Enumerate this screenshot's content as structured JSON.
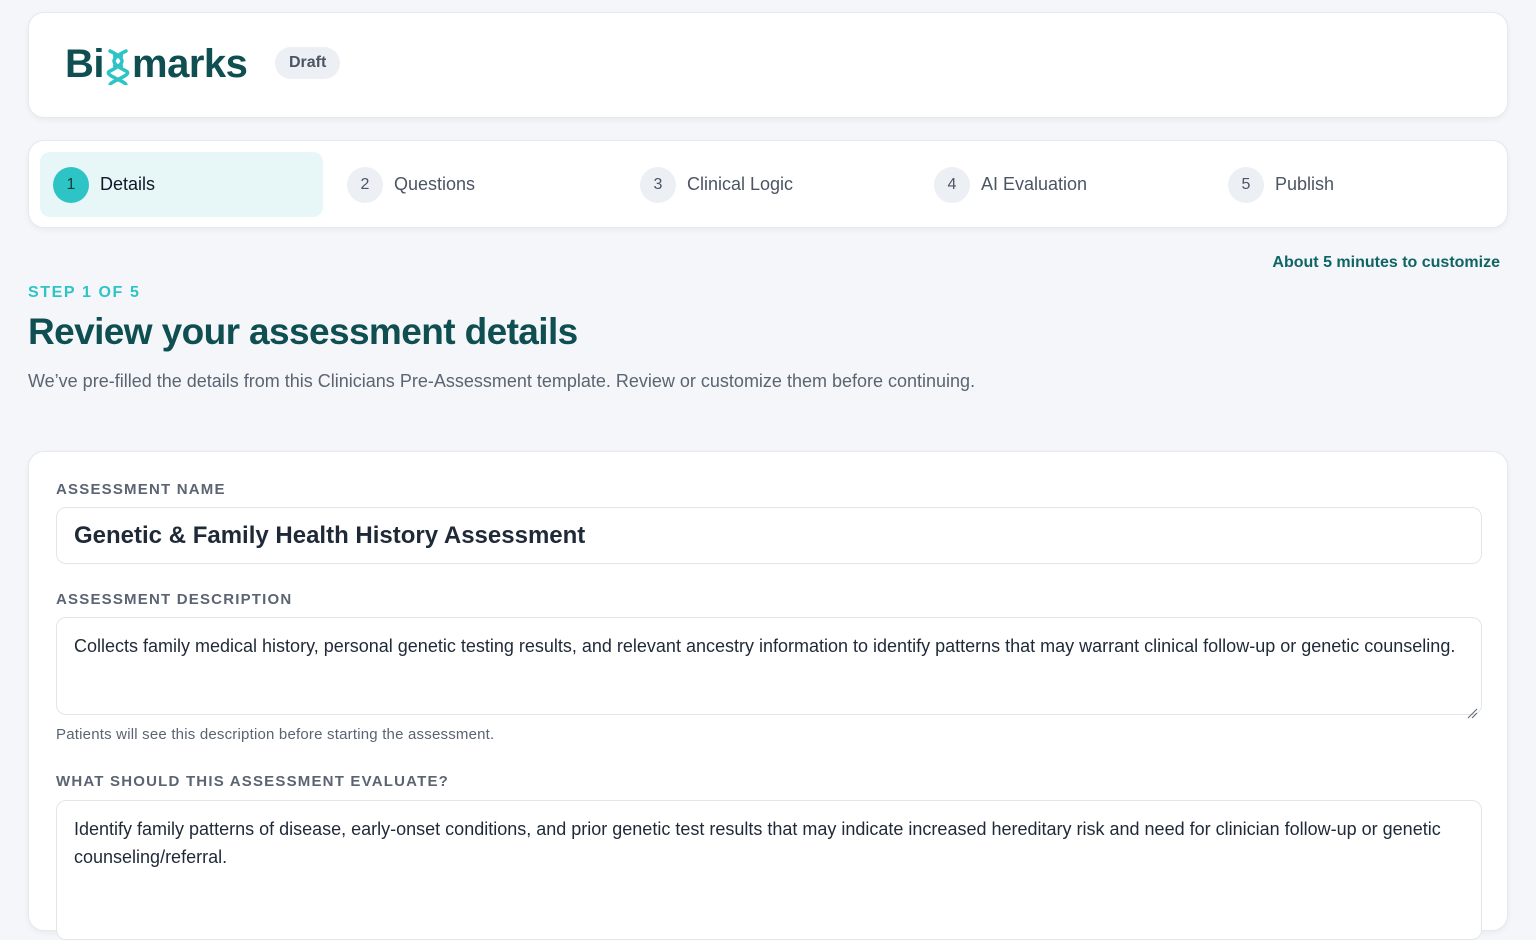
{
  "header": {
    "logo_text_a": "Bi",
    "logo_text_b": "marks",
    "status_badge": "Draft"
  },
  "stepper": {
    "steps": [
      {
        "number": "1",
        "label": "Details",
        "active": true
      },
      {
        "number": "2",
        "label": "Questions",
        "active": false
      },
      {
        "number": "3",
        "label": "Clinical Logic",
        "active": false
      },
      {
        "number": "4",
        "label": "AI Evaluation",
        "active": false
      },
      {
        "number": "5",
        "label": "Publish",
        "active": false
      }
    ]
  },
  "page": {
    "time_estimate": "About 5 minutes to customize",
    "eyebrow": "STEP 1 OF 5",
    "title": "Review your assessment details",
    "subtitle": "We’ve pre-filled the details from this Clinicians Pre-Assessment template. Review or customize them before continuing."
  },
  "form": {
    "name_label": "ASSESSMENT NAME",
    "name_value": "Genetic & Family Health History Assessment",
    "description_label": "ASSESSMENT DESCRIPTION",
    "description_value": "Collects family medical history, personal genetic testing results, and relevant ancestry information to identify patterns that may warrant clinical follow-up or genetic counseling.",
    "description_helper": "Patients will see this description before starting the assessment.",
    "evaluate_label": "WHAT SHOULD THIS ASSESSMENT EVALUATE?",
    "evaluate_value": "Identify family patterns of disease, early-onset conditions, and prior genetic test results that may indicate increased hereditary risk and need for clinician follow-up or genetic counseling/referral."
  },
  "colors": {
    "brand": "#0f4f51",
    "accent": "#2ec4c6",
    "active_step_bg": "#e7f7f7"
  },
  "icons": {
    "logo_glyph": "dna-icon",
    "textarea_resize": "resize-grip-icon"
  }
}
